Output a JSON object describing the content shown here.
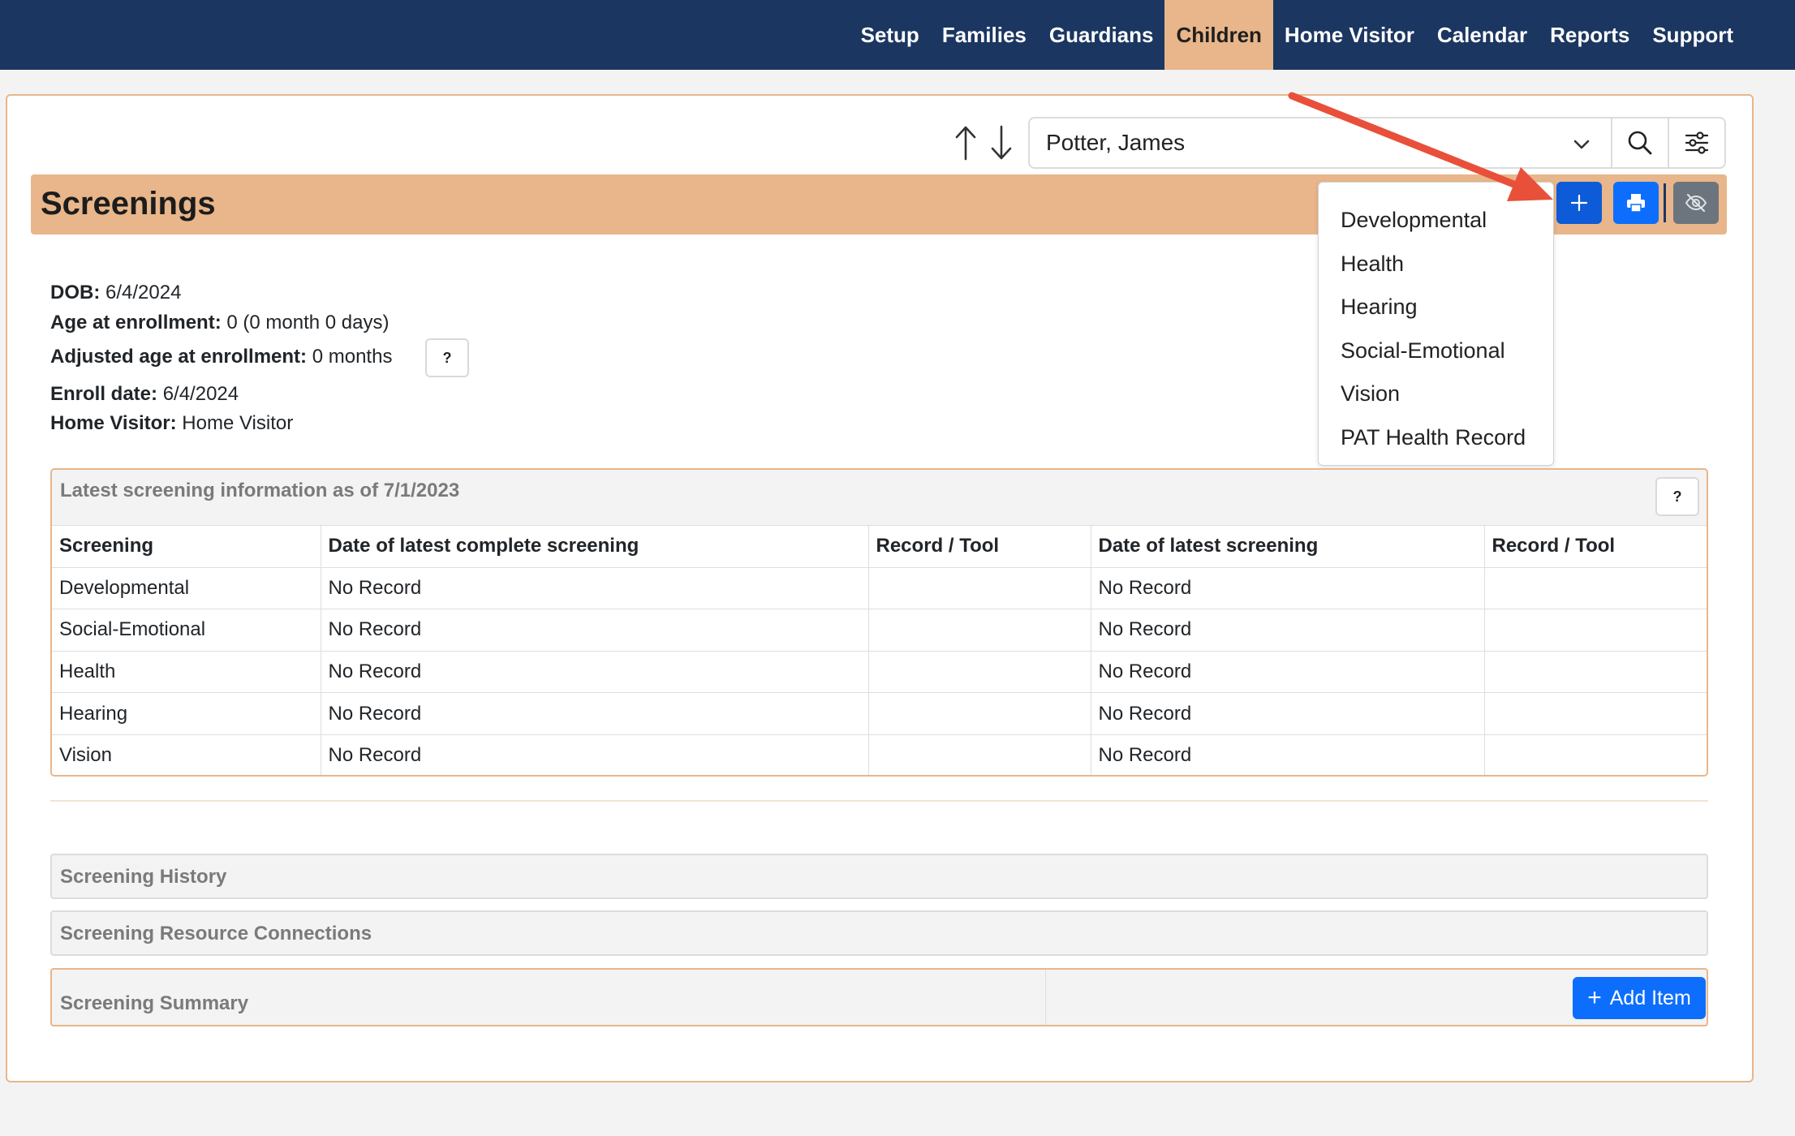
{
  "nav": {
    "items": [
      {
        "label": "Setup"
      },
      {
        "label": "Families"
      },
      {
        "label": "Guardians"
      },
      {
        "label": "Children",
        "active": true
      },
      {
        "label": "Home Visitor"
      },
      {
        "label": "Calendar"
      },
      {
        "label": "Reports"
      },
      {
        "label": "Support"
      }
    ]
  },
  "record_selector": {
    "value": "Potter, James",
    "prev_icon": "arrow-up-icon",
    "next_icon": "arrow-down-icon",
    "search_icon": "search-icon",
    "filter_icon": "sliders-icon"
  },
  "header": {
    "title": "Screenings",
    "add_icon": "plus-icon",
    "print_icon": "printer-icon",
    "hide_icon": "eye-slash-icon"
  },
  "add_menu": {
    "items": [
      "Developmental",
      "Health",
      "Hearing",
      "Social-Emotional",
      "Vision",
      "PAT Health Record"
    ]
  },
  "info": {
    "dob_label": "DOB:",
    "dob": "6/4/2024",
    "age_label": "Age at enrollment:",
    "age": "0 (0 month 0 days)",
    "adj_age_label": "Adjusted age at enrollment:",
    "adj_age": "0 months",
    "help": "?",
    "enroll_label": "Enroll date:",
    "enroll": "6/4/2024",
    "visitor_label": "Home Visitor:",
    "visitor": "Home Visitor"
  },
  "latest": {
    "title": "Latest screening information as of 7/1/2023",
    "help": "?",
    "columns": [
      "Screening",
      "Date of latest complete screening",
      "Record / Tool",
      "Date of latest screening",
      "Record / Tool"
    ],
    "rows": [
      [
        "Developmental",
        "No Record",
        "",
        "No Record",
        ""
      ],
      [
        "Social-Emotional",
        "No Record",
        "",
        "No Record",
        ""
      ],
      [
        "Health",
        "No Record",
        "",
        "No Record",
        ""
      ],
      [
        "Hearing",
        "No Record",
        "",
        "No Record",
        ""
      ],
      [
        "Vision",
        "No Record",
        "",
        "No Record",
        ""
      ]
    ]
  },
  "sections": {
    "history": "Screening History",
    "resources": "Screening Resource Connections",
    "summary": "Screening Summary",
    "add_item": "Add Item"
  },
  "colors": {
    "nav_bg": "#1b3660",
    "accent": "#e8b68a",
    "primary_button": "#0d6efd",
    "secondary_button": "#6c757d",
    "annotation_arrow": "#e8503a"
  }
}
